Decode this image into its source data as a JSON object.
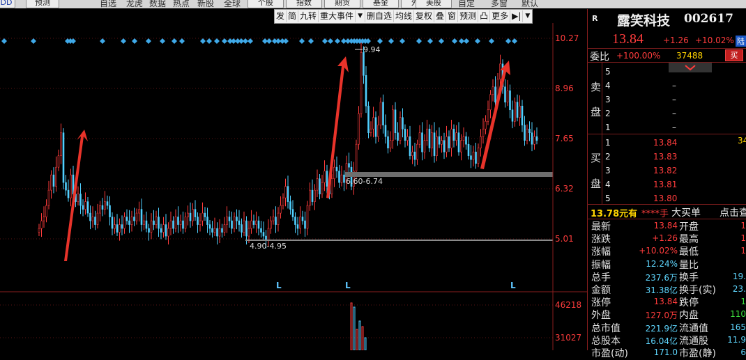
{
  "top_buttons": [
    "DD",
    "预测",
    "个股",
    "指数",
    "期货",
    "基金",
    "外汇",
    "美股"
  ],
  "top_menu": [
    "自选",
    "龙虎",
    "数据",
    "热点",
    "新股",
    "全球",
    "自定",
    "多窗",
    "默认"
  ],
  "toolbar": [
    "发",
    "简",
    "九转",
    "重大事件",
    "▼",
    "删自选",
    "均线",
    "复权",
    "叠",
    "窗",
    "预测",
    "凸",
    "更多",
    "▶|",
    "▼"
  ],
  "stock": {
    "tag": "R",
    "name": "露笑科技",
    "code": "002617",
    "price": "13.84",
    "change": "+1.26",
    "change_pct": "+10.02%",
    "badge": "陆"
  },
  "weibi": {
    "label": "委比",
    "value": "+100.00%",
    "volume": "37488",
    "buy_btn": "买"
  },
  "sell_side": {
    "label1": "卖",
    "label2": "盘",
    "levels": [
      {
        "n": "5",
        "price": "–"
      },
      {
        "n": "4",
        "price": "–"
      },
      {
        "n": "3",
        "price": "–"
      },
      {
        "n": "2",
        "price": "–"
      },
      {
        "n": "1",
        "price": "–"
      }
    ]
  },
  "buy_side": {
    "label1": "买",
    "label2": "盘",
    "levels": [
      {
        "n": "1",
        "price": "13.84",
        "vol": "34"
      },
      {
        "n": "2",
        "price": "13.83",
        "vol": ""
      },
      {
        "n": "3",
        "price": "13.82",
        "vol": ""
      },
      {
        "n": "4",
        "price": "13.81",
        "vol": ""
      },
      {
        "n": "5",
        "price": "13.80",
        "vol": ""
      }
    ]
  },
  "quote_header": {
    "price": "13.78元有",
    "hands": "****手",
    "big": "大买单",
    "click": "点击查"
  },
  "quote_rows": [
    {
      "l1": "最新",
      "v1": "13.84",
      "c1": "red",
      "l2": "开盘",
      "v2": "1",
      "c2": "red"
    },
    {
      "l1": "涨跌",
      "v1": "+1.26",
      "c1": "red",
      "l2": "最高",
      "v2": "1",
      "c2": "red"
    },
    {
      "l1": "涨幅",
      "v1": "+10.02%",
      "c1": "red",
      "l2": "最低",
      "v2": "1",
      "c2": "red"
    },
    {
      "l1": "振幅",
      "v1": "12.24%",
      "c1": "cyan",
      "l2": "量比",
      "v2": "",
      "c2": "cyan"
    },
    {
      "l1": "总手",
      "v1": "237.6万",
      "c1": "cyan",
      "l2": "换手",
      "v2": "19.",
      "c2": "cyan"
    },
    {
      "l1": "金额",
      "v1": "31.38亿",
      "c1": "cyan",
      "l2": "换手(实)",
      "v2": "23.",
      "c2": "cyan"
    },
    {
      "l1": "涨停",
      "v1": "13.84",
      "c1": "red",
      "l2": "跌停",
      "v2": "1",
      "c2": "green"
    },
    {
      "l1": "外盘",
      "v1": "127.0万",
      "c1": "red",
      "l2": "内盘",
      "v2": "110",
      "c2": "green"
    },
    {
      "l1": "总市值",
      "v1": "221.9亿",
      "c1": "cyan",
      "l2": "流通值",
      "v2": "165",
      "c2": "cyan"
    },
    {
      "l1": "总股本",
      "v1": "16.04亿",
      "c1": "cyan",
      "l2": "流通股",
      "v2": "11.9",
      "c2": "cyan"
    },
    {
      "l1": "市盈(动)",
      "v1": "171.0",
      "c1": "cyan",
      "l2": "市盈(静)",
      "v2": "6",
      "c2": "cyan"
    }
  ],
  "chart_data": {
    "type": "candlestick",
    "y_ticks": [
      "10.27",
      "8.96",
      "7.65",
      "6.32",
      "5.01"
    ],
    "volume_ticks": [
      "46218",
      "31027"
    ],
    "annotations": {
      "high_label": "9.94",
      "zone_upper": "6.60-6.74",
      "zone_lower": "4.90-4.95"
    },
    "signals": [
      "L",
      "L",
      "L"
    ],
    "closes": [
      5.3,
      5.5,
      5.6,
      5.9,
      6.3,
      6.7,
      6.4,
      6.9,
      7.2,
      7.8,
      6.5,
      6.3,
      6.1,
      6.7,
      6.2,
      6.0,
      6.2,
      5.9,
      5.8,
      6.0,
      5.7,
      5.5,
      5.6,
      5.4,
      5.7,
      5.9,
      5.8,
      6.0,
      5.9,
      5.6,
      5.3,
      5.4,
      5.2,
      5.4,
      5.3,
      5.6,
      5.5,
      5.4,
      5.6,
      5.5,
      5.7,
      5.8,
      5.4,
      5.5,
      5.3,
      5.2,
      5.5,
      5.4,
      5.6,
      5.3,
      5.2,
      5.4,
      5.1,
      5.3,
      5.5,
      5.3,
      5.6,
      5.4,
      5.5,
      5.3,
      5.6,
      5.7,
      5.5,
      5.8,
      5.6,
      5.4,
      5.5,
      5.7,
      5.6,
      5.4,
      5.3,
      5.2,
      5.3,
      5.1,
      5.3,
      5.2,
      5.4,
      5.6,
      5.5,
      5.3,
      5.6,
      5.5,
      5.4,
      5.2,
      5.5,
      5.1,
      5.3,
      5.5,
      5.4,
      5.5,
      5.3,
      5.2,
      5.1,
      5.0,
      5.3,
      5.5,
      5.6,
      5.4,
      5.7,
      5.9,
      6.1,
      6.4,
      6.0,
      5.8,
      5.6,
      5.4,
      5.3,
      5.6,
      5.5,
      5.3,
      5.9,
      6.3,
      6.0,
      6.3,
      6.6,
      6.2,
      6.5,
      6.8,
      6.4,
      6.2,
      6.6,
      6.9,
      6.8,
      6.5,
      6.7,
      6.5,
      7.0,
      6.9,
      6.4,
      6.8,
      7.5,
      8.3,
      9.9,
      9.3,
      8.5,
      7.8,
      7.9,
      8.2,
      7.7,
      8.0,
      8.6,
      8.0,
      7.7,
      7.4,
      7.6,
      8.4,
      7.8,
      7.6,
      8.2,
      7.9,
      7.6,
      7.7,
      7.2,
      7.3,
      7.1,
      7.5,
      7.8,
      7.3,
      7.6,
      7.9,
      7.4,
      7.8,
      7.2,
      7.7,
      7.5,
      7.6,
      7.3,
      7.7,
      7.4,
      7.9,
      7.6,
      7.8,
      7.3,
      7.6,
      7.7,
      7.5,
      7.2,
      7.1,
      7.3,
      7.0,
      7.4,
      7.7,
      7.9,
      8.1,
      8.4,
      8.8,
      9.0,
      8.6,
      9.2,
      9.6,
      9.0,
      8.6,
      8.9,
      8.4,
      8.1,
      8.6,
      8.2,
      8.5,
      8.0,
      7.6,
      7.9,
      7.8,
      7.5,
      7.7,
      7.6
    ]
  }
}
